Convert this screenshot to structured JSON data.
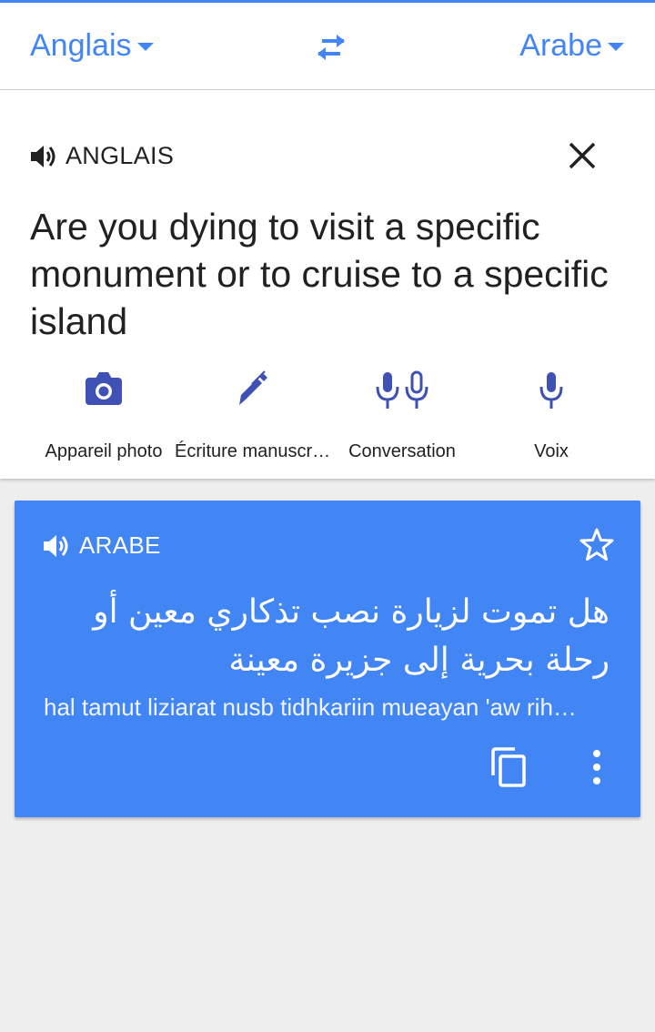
{
  "colors": {
    "accent": "#4285f4",
    "text": "#212121",
    "background": "#eeeeee",
    "tool_icon": "#3f51b5"
  },
  "language_bar": {
    "source_language": "Anglais",
    "target_language": "Arabe",
    "source_dropdown_icon": "arrow-drop-down-icon",
    "swap_icon": "swap-horizontal-icon"
  },
  "input": {
    "language_label": "ANGLAIS",
    "speaker_icon": "volume-icon",
    "close_icon": "close-icon",
    "text": "Are you dying to visit a specific monument or to cruise to a specific island"
  },
  "tools": [
    {
      "label": "Appareil photo",
      "icon": "camera-icon"
    },
    {
      "label": "Écriture manuscr…",
      "icon": "pen-icon"
    },
    {
      "label": "Conversation",
      "icon": "dual-microphone-icon"
    },
    {
      "label": "Voix",
      "icon": "microphone-icon"
    }
  ],
  "result": {
    "language_label": "ARABE",
    "speaker_icon": "volume-icon",
    "star_icon": "star-outline-icon",
    "text": "هل تموت لزيارة نصب تذكاري معين أو رحلة بحرية إلى جزيرة معينة",
    "transliteration": "hal tamut liziarat nusb tidhkariin mueayan 'aw rih…",
    "copy_icon": "copy-icon",
    "more_icon": "more-vertical-icon"
  }
}
